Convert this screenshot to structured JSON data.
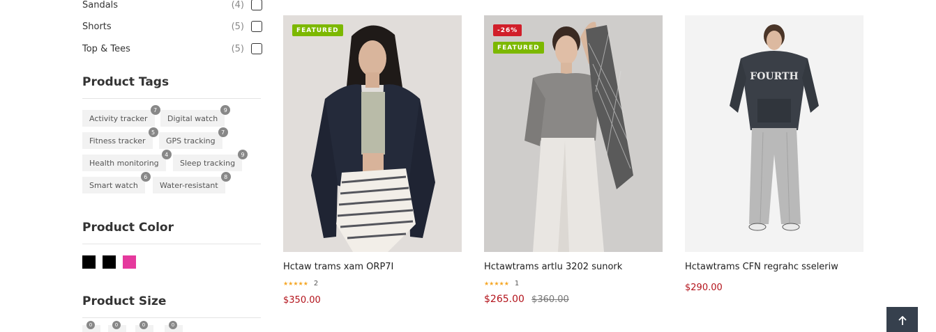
{
  "categories": [
    {
      "label": "Sandals",
      "count": "(4)"
    },
    {
      "label": "Shorts",
      "count": "(5)"
    },
    {
      "label": "Top & Tees",
      "count": "(5)"
    }
  ],
  "tags_section": {
    "title": "Product Tags"
  },
  "tags": [
    {
      "label": "Activity tracker",
      "count": "7"
    },
    {
      "label": "Digital watch",
      "count": "9"
    },
    {
      "label": "Fitness tracker",
      "count": "5"
    },
    {
      "label": "GPS tracking",
      "count": "7"
    },
    {
      "label": "Health monitoring",
      "count": "4"
    },
    {
      "label": "Sleep tracking",
      "count": "9"
    },
    {
      "label": "Smart watch",
      "count": "6"
    },
    {
      "label": "Water-resistant",
      "count": "8"
    }
  ],
  "color_section": {
    "title": "Product Color"
  },
  "colors": [
    "#000000",
    "#000000",
    "#e5399d"
  ],
  "size_section": {
    "title": "Product Size"
  },
  "size_counts": [
    "0",
    "0",
    "0",
    "0"
  ],
  "products": [
    {
      "name": "Hctaw trams xam ORP7I",
      "badges": [
        "FEATURED"
      ],
      "rating_count": "2",
      "stars": "★★★★★",
      "price": "$350.00"
    },
    {
      "name": "Hctawtrams artlu 3202 sunork",
      "badges": [
        "-26%",
        "FEATURED"
      ],
      "rating_count": "1",
      "stars": "★★★★★",
      "price": "$265.00",
      "old_price": "$360.00"
    },
    {
      "name": "Hctawtrams CFN regrahc sseleriw",
      "badges": [],
      "price": "$290.00",
      "hoodie_text": "FOURTH"
    }
  ],
  "colors_theme": {
    "featured": "#7cb800",
    "sale": "#d11f2a",
    "price": "#b3131b",
    "star": "#f5a623"
  },
  "back_to_top": {
    "icon": "arrow-up-icon"
  }
}
